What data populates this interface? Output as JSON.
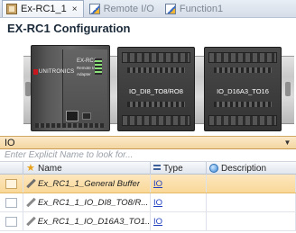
{
  "tabs": [
    {
      "label": "Ex-RC1_1",
      "active": true,
      "icon": "rack-icon",
      "close": "×"
    },
    {
      "label": "Remote I/O",
      "active": false,
      "icon": "edit-icon"
    },
    {
      "label": "Function1",
      "active": false,
      "icon": "edit-icon"
    }
  ],
  "config": {
    "title": "EX-RC1 Configuration",
    "adapter": {
      "brand": "UNITRONICS",
      "model_line1": "EX-RC1",
      "model_line2": "Remote I/O Adapter"
    },
    "modules": [
      {
        "label": "IO_DI8_TO8/RO8"
      },
      {
        "label": "IO_D16A3_TO16"
      }
    ]
  },
  "filter": {
    "value": "IO",
    "dropdown_icon": "▼"
  },
  "search": {
    "placeholder": "Enter Explicit Name to look for..."
  },
  "grid": {
    "columns": [
      {
        "label": ""
      },
      {
        "label": "Name",
        "icon": "star-icon"
      },
      {
        "label": "Type",
        "icon": "type-icon"
      },
      {
        "label": "Description",
        "icon": "description-icon"
      }
    ],
    "rows": [
      {
        "name": "Ex_RC1_1_General Buffer",
        "type": "IO",
        "description": "",
        "selected": true
      },
      {
        "name": "Ex_RC1_1_IO_DI8_TO8/R...",
        "type": "IO",
        "description": "",
        "selected": false
      },
      {
        "name": "Ex_RC1_1_IO_D16A3_TO1...",
        "type": "IO",
        "description": "",
        "selected": false
      }
    ]
  },
  "colors": {
    "selection": "#f9d898",
    "filter_bar": "#f3d6a1",
    "link": "#1f3fbf",
    "tab_strip": "#d6dde8"
  }
}
